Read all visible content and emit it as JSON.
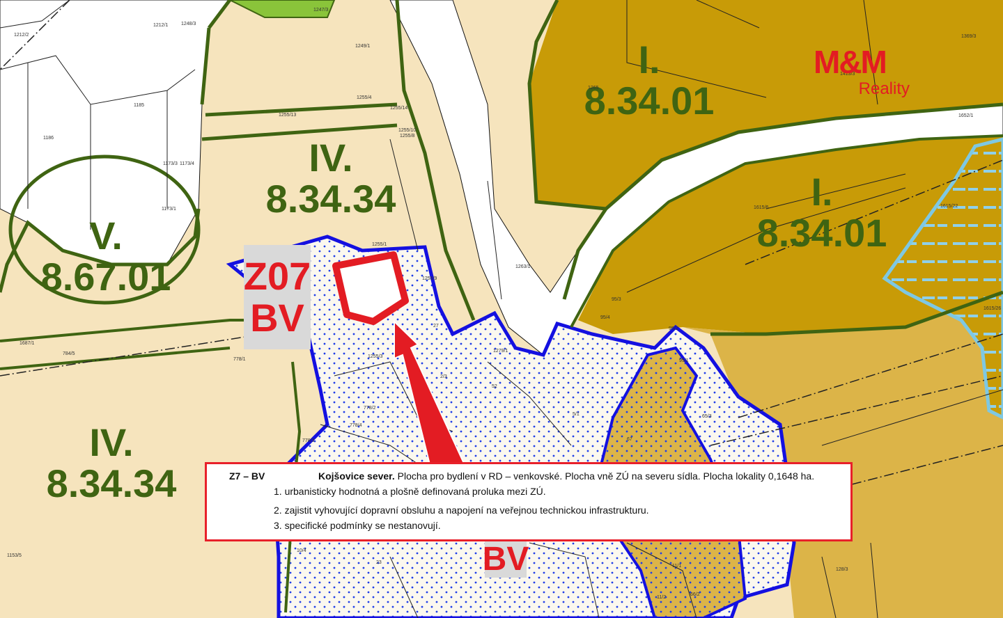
{
  "zones": [
    {
      "roman": "IV.",
      "code": "8.34.34"
    },
    {
      "roman": "V.",
      "code": "8.67.01"
    },
    {
      "roman": "IV.",
      "code": "8.34.34"
    },
    {
      "roman": "I.",
      "code": "8.34.01"
    },
    {
      "roman": "I.",
      "code": "8.34.01"
    }
  ],
  "marker": {
    "code": "Z07",
    "type": "BV"
  },
  "bv_label": "BV",
  "logo": {
    "main": "M&M",
    "sub": "Reality"
  },
  "infobox": {
    "code": "Z7 – BV",
    "name": "Kojšovice sever.",
    "description": "Plocha pro bydlení v RD – venkovské. Plocha vně ZÚ na severu sídla. Plocha lokality 0,1648 ha.",
    "items": [
      "1. urbanisticky hodnotná a plošně definovaná proluka mezi ZÚ.",
      "2. zajistit vyhovující dopravní obsluhu a napojení na veřejnou technickou infrastrukturu.",
      "3. specifické podmínky se nestanovují."
    ]
  },
  "parcels": [
    "1212/2",
    "1212/1",
    "1248/3",
    "1247/3",
    "1249/1",
    "1255/4",
    "1255/13",
    "1255/14",
    "1255/10",
    "1255/8",
    "1186",
    "1185",
    "1173/1",
    "1173/3",
    "1173/4",
    "1255/1",
    "1255/9",
    "1263/1",
    "1265",
    "1413/3",
    "1369/3",
    "1652/1",
    "1615/6",
    "1615/22",
    "1615/26",
    "95/3",
    "95/4",
    "95/2",
    "95/1",
    "27",
    "1279/1",
    "1255/3",
    "2/3",
    "52",
    "778/2",
    "778/4",
    "778/3",
    "778/1",
    "784/5",
    "1687/1",
    "1153/5",
    "5/1",
    "67",
    "65/3",
    "10/4",
    "23",
    "11/1",
    "11/2",
    "66/2",
    "128/3"
  ],
  "colors": {
    "residential_fill": "#f6e4bd",
    "agri_fill": "#c89b07",
    "agri_light_fill": "#dcb448",
    "boundary_green": "#3f6412",
    "built_blue": "#1410e0",
    "water_blue": "#7ec8e3",
    "forest_green": "#8ac43a",
    "highlight_red": "#e31c23"
  }
}
